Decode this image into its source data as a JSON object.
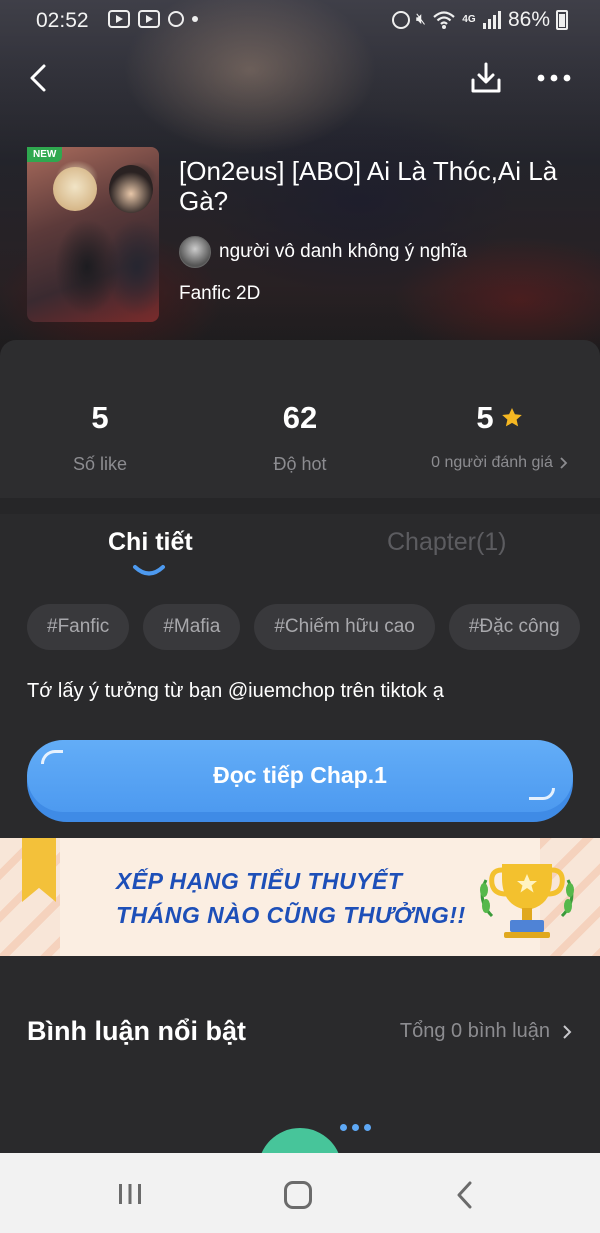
{
  "status_bar": {
    "time": "02:52",
    "network": "4G",
    "battery": "86%"
  },
  "book": {
    "badge": "NEW",
    "title": "[On2eus] [ABO] Ai Là Thóc,Ai Là Gà?",
    "author": "người vô danh không ý nghĩa",
    "genre": "Fanfic 2D"
  },
  "stats": {
    "likes": {
      "value": "5",
      "label": "Số like"
    },
    "hot": {
      "value": "62",
      "label": "Độ hot"
    },
    "rating": {
      "value": "5",
      "label": "0 người đánh giá"
    }
  },
  "tabs": {
    "detail": "Chi tiết",
    "chapter": "Chapter(1)"
  },
  "tags": [
    "#Fanfic",
    "#Mafia",
    "#Chiếm hữu cao",
    "#Đặc công"
  ],
  "description": "Tớ lấy ý tưởng từ bạn @iuemchop trên tiktok ạ",
  "read_button": "Đọc tiếp Chap.1",
  "banner": {
    "line1": "XẾP HẠNG TIỂU THUYẾT",
    "line2": "THÁNG NÀO CŨNG THƯỞNG!!"
  },
  "comments": {
    "title": "Bình luận nổi bật",
    "total": "Tổng 0 bình luận"
  },
  "colors": {
    "accent_blue": "#4d9af0",
    "star": "#f5b722",
    "background": "#2a2a2c",
    "fab_green": "#47c59a"
  },
  "icons": [
    "back-icon",
    "download-icon",
    "more-icon",
    "star-icon",
    "chevron-right-icon",
    "recent-apps-icon",
    "home-icon",
    "nav-back-icon"
  ]
}
